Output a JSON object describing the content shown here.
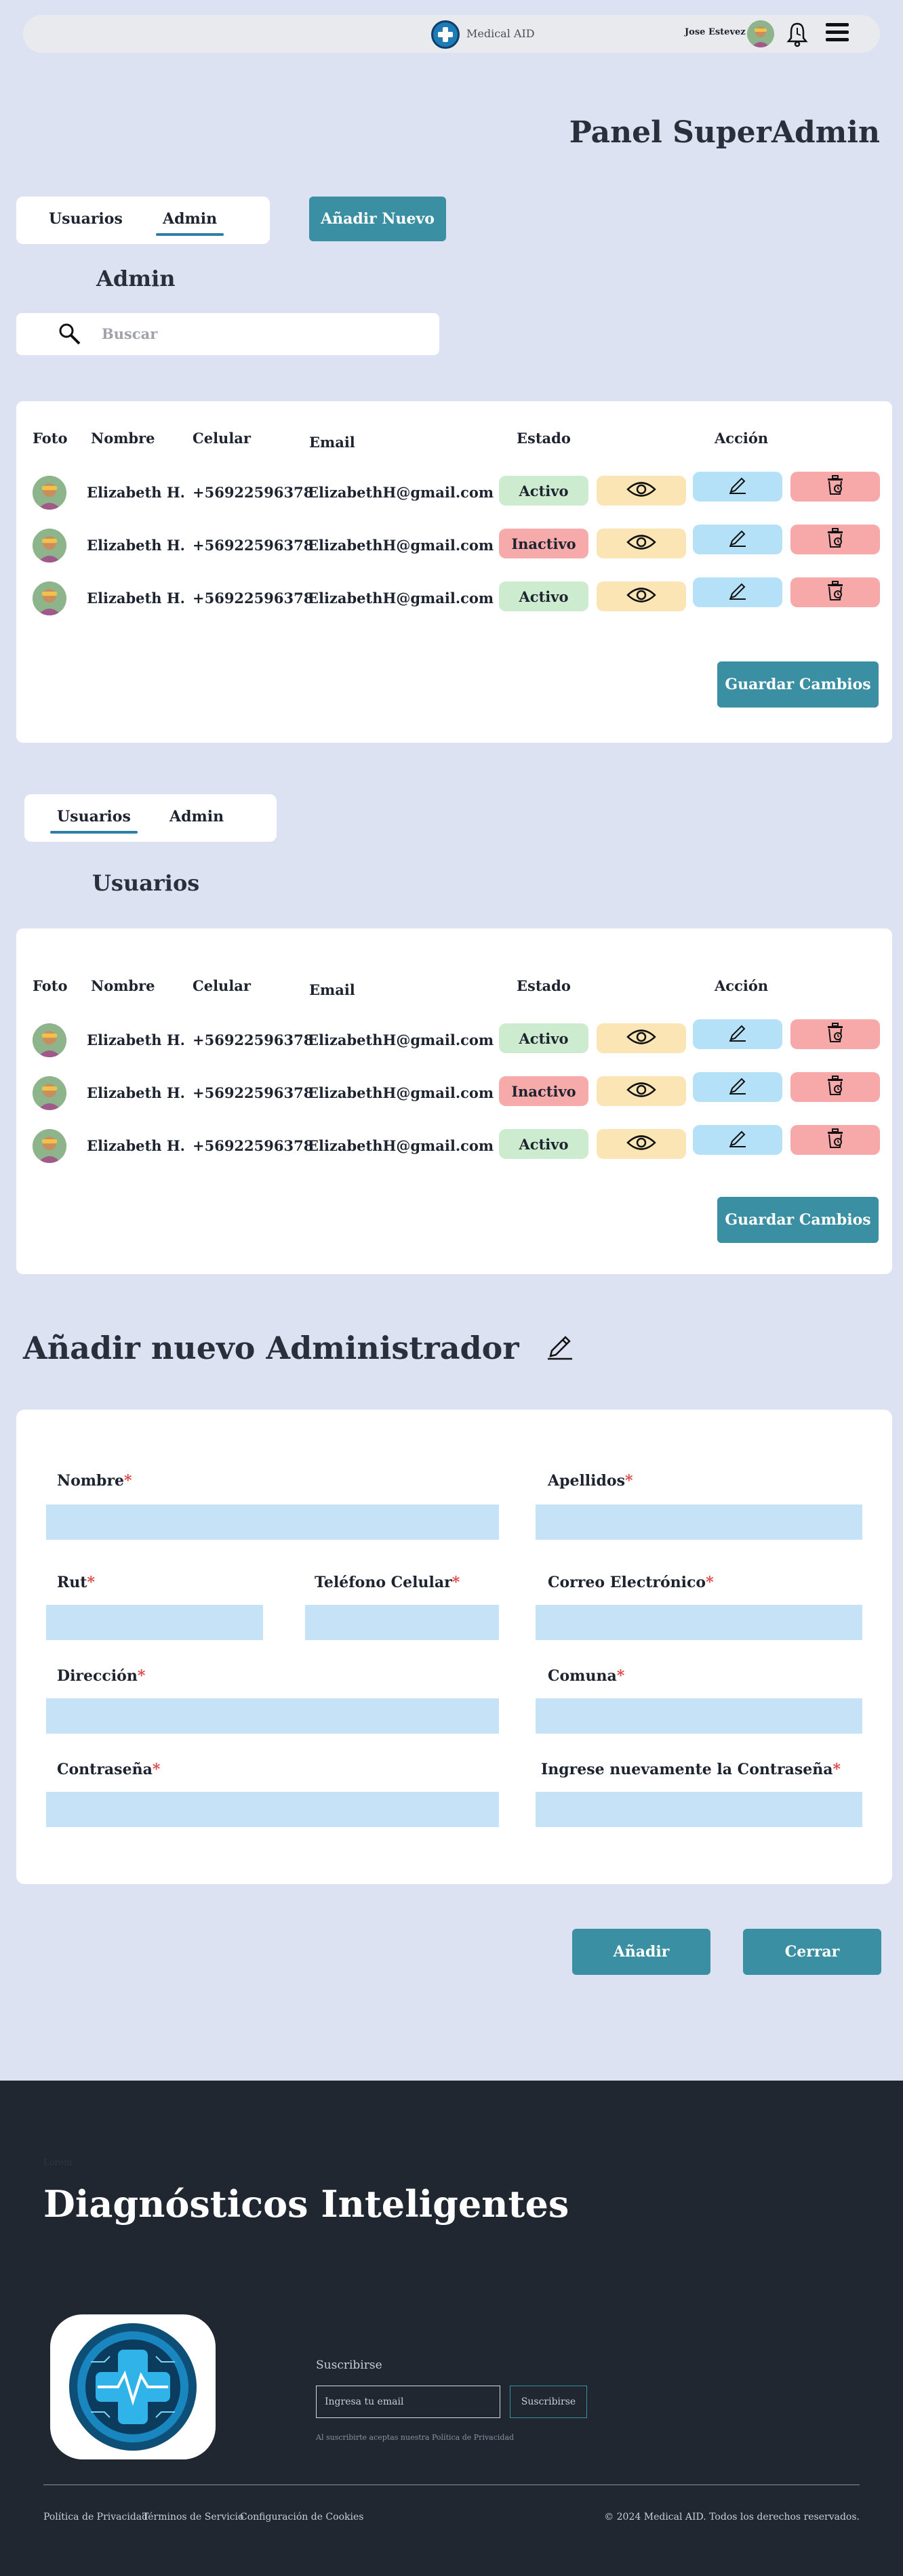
{
  "header": {
    "brand": "Medical AID",
    "user_name": "Jose Estevez"
  },
  "page": {
    "title": "Panel SuperAdmin"
  },
  "admin_section": {
    "tabs": [
      "Usuarios",
      "Admin"
    ],
    "active_tab": "Admin",
    "add_new_label": "Añadir Nuevo",
    "label": "Admin",
    "search_placeholder": "Buscar"
  },
  "users_section": {
    "tabs": [
      "Usuarios",
      "Admin"
    ],
    "active_tab": "Usuarios",
    "label": "Usuarios"
  },
  "table": {
    "headers": {
      "foto": "Foto",
      "nombre": "Nombre",
      "celular": "Celular",
      "email": "Email",
      "estado": "Estado",
      "accion": "Acción"
    },
    "save_label": "Guardar Cambios"
  },
  "admin_rows": [
    {
      "nombre": "Elizabeth H.",
      "celular": "+56922596378",
      "email": "ElizabethH@gmail.com",
      "estado": "Activo"
    },
    {
      "nombre": "Elizabeth H.",
      "celular": "+56922596378",
      "email": "ElizabethH@gmail.com",
      "estado": "Inactivo"
    },
    {
      "nombre": "Elizabeth H.",
      "celular": "+56922596378",
      "email": "ElizabethH@gmail.com",
      "estado": "Activo"
    }
  ],
  "user_rows": [
    {
      "nombre": "Elizabeth H.",
      "celular": "+56922596378",
      "email": "ElizabethH@gmail.com",
      "estado": "Activo"
    },
    {
      "nombre": "Elizabeth H.",
      "celular": "+56922596378",
      "email": "ElizabethH@gmail.com",
      "estado": "Inactivo"
    },
    {
      "nombre": "Elizabeth H.",
      "celular": "+56922596378",
      "email": "ElizabethH@gmail.com",
      "estado": "Activo"
    }
  ],
  "form": {
    "title": "Añadir nuevo Administrador",
    "fields": {
      "nombre": "Nombre",
      "apellidos": "Apellidos",
      "rut": "Rut",
      "telefono": "Teléfono Celular",
      "correo": "Correo Electrónico",
      "direccion": "Dirección",
      "comuna": "Comuna",
      "contrasena": "Contraseña",
      "contrasena2": "Ingrese nuevamente la Contraseña"
    },
    "required_mark": "*",
    "add_label": "Añadir",
    "close_label": "Cerrar"
  },
  "footer": {
    "eyebrow": "Lorem",
    "title": "Diagnósticos Inteligentes",
    "subscribe_label": "Suscribirse",
    "email_placeholder": "Ingresa tu email",
    "subscribe_button": "Suscribirse",
    "note": "Al suscribirte aceptas nuestra Política de Privacidad",
    "links": [
      "Política de Privacidad",
      "Términos de Servicio",
      "Configuración de Cookies"
    ],
    "copyright": "© 2024 Medical AID. Todos los derechos reservados."
  },
  "colors": {
    "background": "#dde2f3",
    "accent": "#3b8fa3",
    "status_active": "#cdeccf",
    "status_inactive": "#f6aaaa",
    "view": "#fbe5b5",
    "edit": "#b5e1f8",
    "delete": "#f7a9a9",
    "footer": "#212731",
    "input": "#c6e2f7"
  },
  "icons": {
    "logo": "medical-cross-icon",
    "notifications": "bell-icon",
    "menu": "hamburger-menu-icon",
    "search": "magnifier-icon",
    "view": "eye-icon",
    "edit": "pencil-icon",
    "delete": "trash-icon"
  }
}
